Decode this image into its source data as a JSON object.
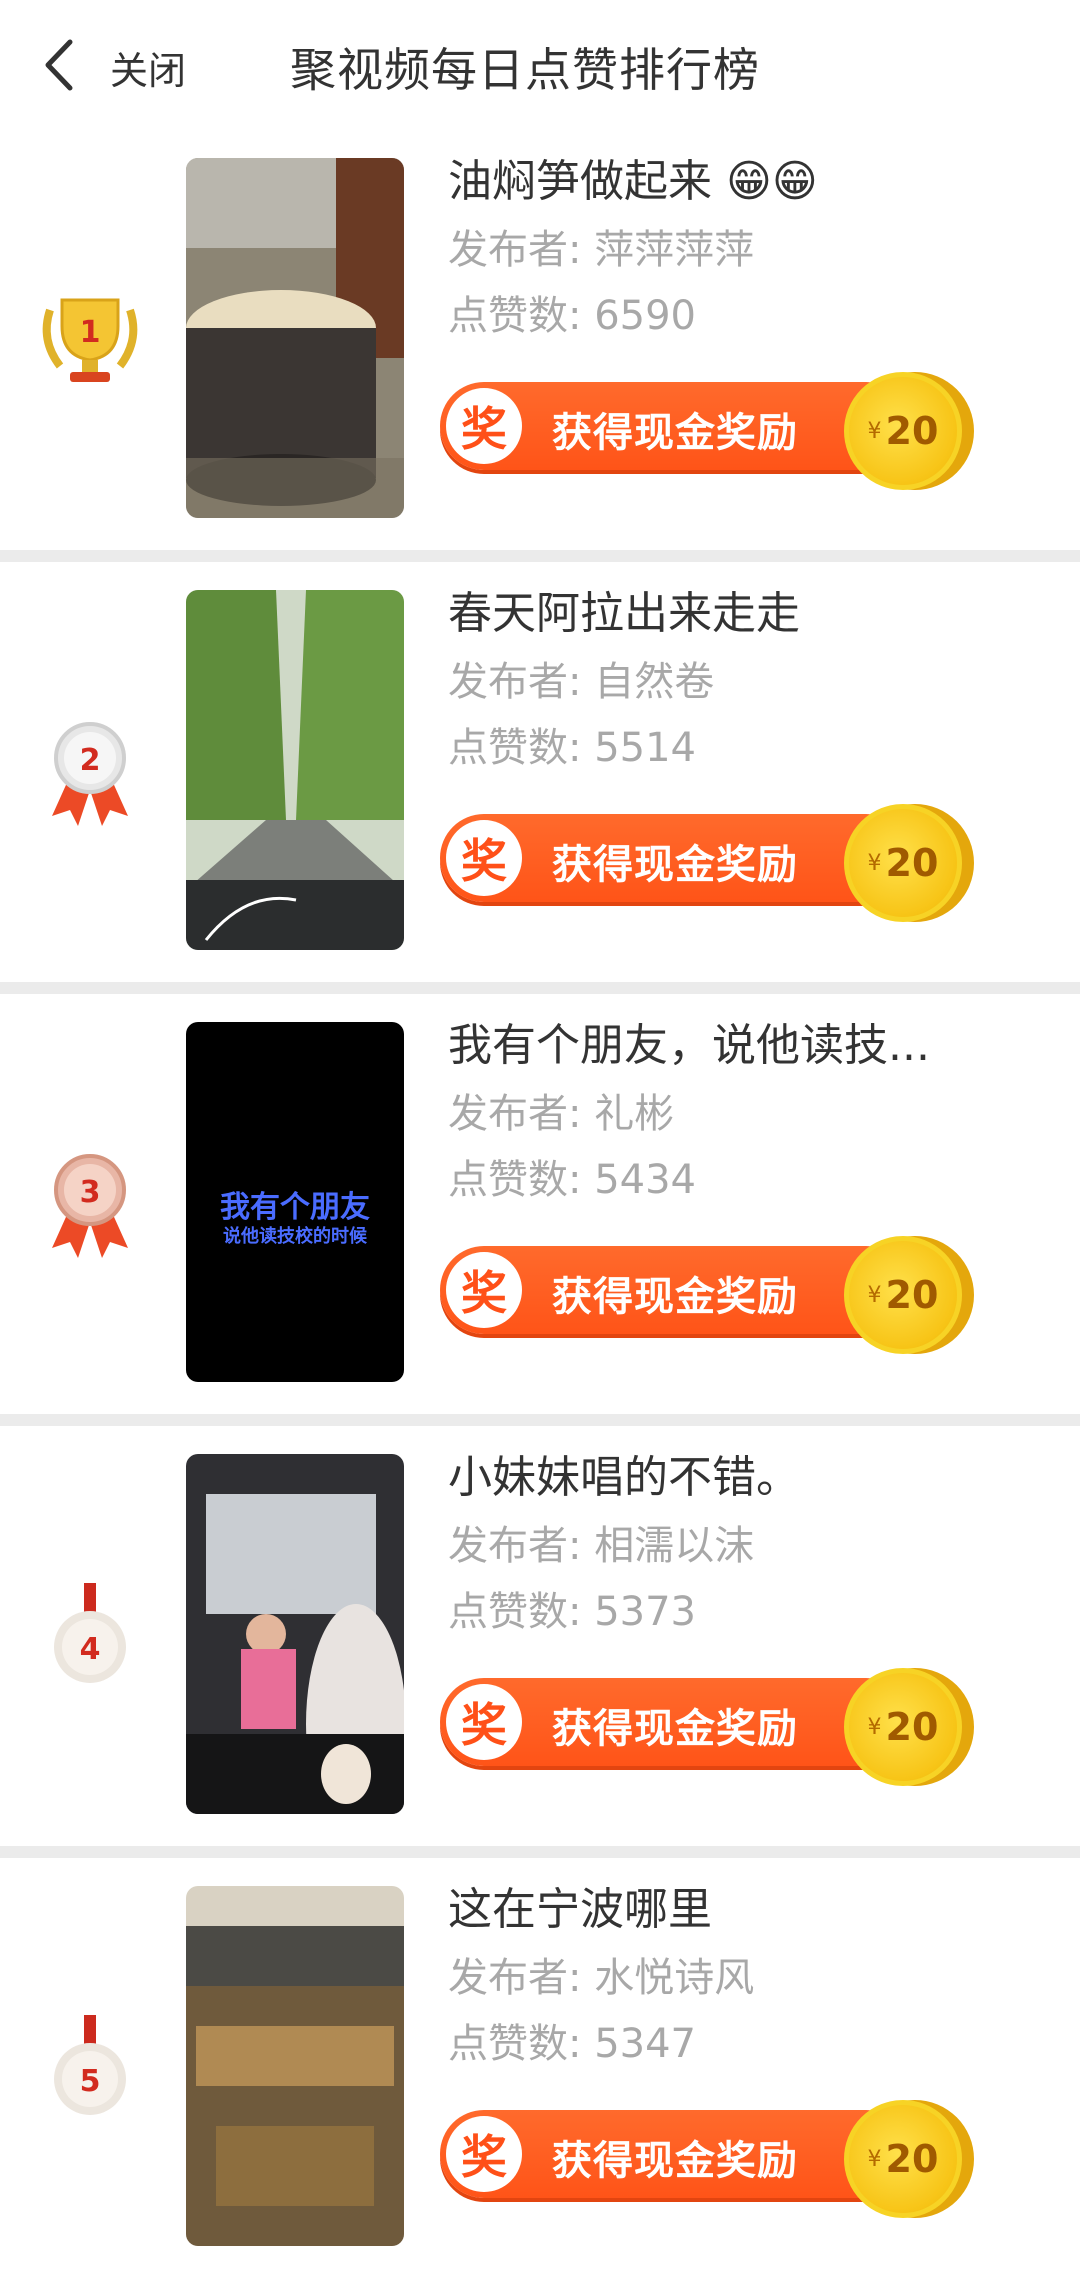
{
  "header": {
    "close_label": "关闭",
    "title": "聚视频每日点赞排行榜"
  },
  "items": [
    {
      "rank": "1",
      "title": "油焖笋做起来 😁😁",
      "publisher": "发布者: 萍萍萍萍",
      "likes": "点赞数: 6590",
      "reward_label": "获得现金奖励",
      "reward_badge": "奖",
      "coin_currency": "¥",
      "coin_value": "20",
      "medal": "trophy"
    },
    {
      "rank": "2",
      "title": "春天阿拉出来走走",
      "publisher": "发布者: 自然卷",
      "likes": "点赞数: 5514",
      "reward_label": "获得现金奖励",
      "reward_badge": "奖",
      "coin_currency": "¥",
      "coin_value": "20",
      "medal": "ribbon-silver"
    },
    {
      "rank": "3",
      "title": "我有个朋友，说他读技...",
      "publisher": "发布者: 礼彬",
      "likes": "点赞数: 5434",
      "reward_label": "获得现金奖励",
      "reward_badge": "奖",
      "coin_currency": "¥",
      "coin_value": "20",
      "medal": "ribbon-bronze",
      "thumb_text_1": "我有个朋友",
      "thumb_text_2": "说他读技校的时候"
    },
    {
      "rank": "4",
      "title": "小妹妹唱的不错。",
      "publisher": "发布者: 相濡以沫",
      "likes": "点赞数: 5373",
      "reward_label": "获得现金奖励",
      "reward_badge": "奖",
      "coin_currency": "¥",
      "coin_value": "20",
      "medal": "pin"
    },
    {
      "rank": "5",
      "title": "这在宁波哪里",
      "publisher": "发布者: 水悦诗风",
      "likes": "点赞数: 5347",
      "reward_label": "获得现金奖励",
      "reward_badge": "奖",
      "coin_currency": "¥",
      "coin_value": "20",
      "medal": "pin"
    }
  ],
  "colors": {
    "accent": "#ff5a1f",
    "coin": "#f7c416",
    "divider": "#ebebeb"
  }
}
